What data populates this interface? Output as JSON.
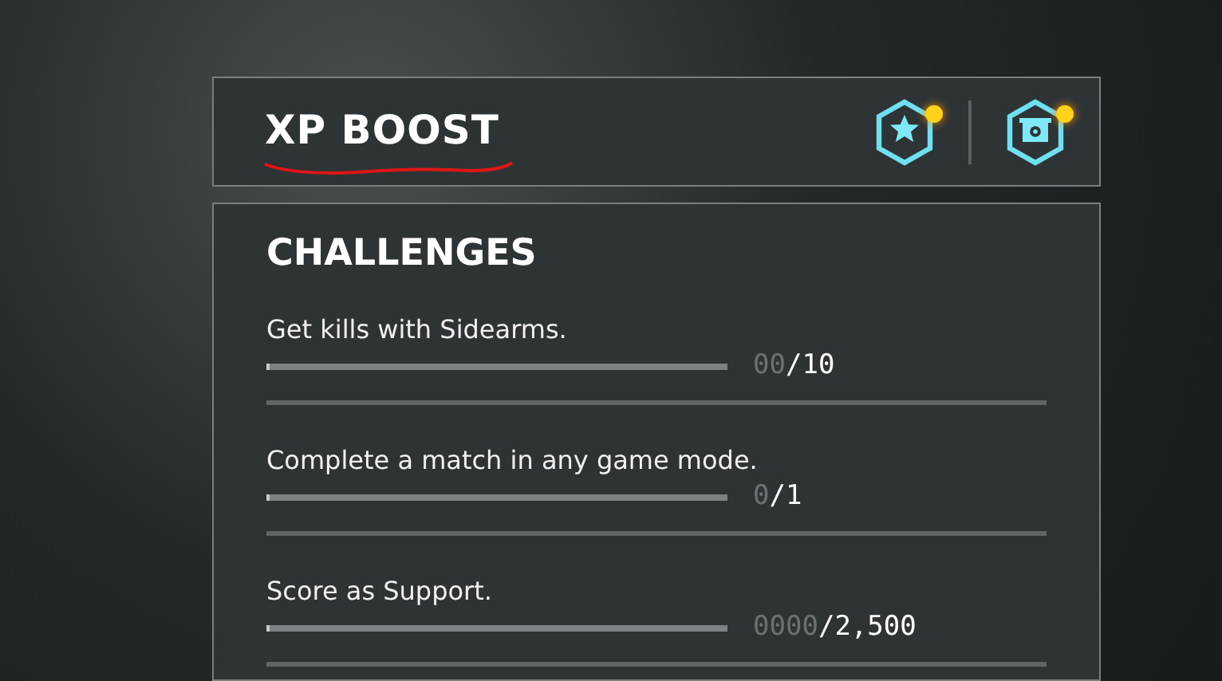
{
  "header": {
    "title": "XP BOOST",
    "title_underlined": true,
    "badges": [
      {
        "kind": "star",
        "notification": true
      },
      {
        "kind": "gear",
        "notification": true
      }
    ]
  },
  "challenges": {
    "title": "CHALLENGES",
    "items": [
      {
        "label": "Get kills with Sidearms.",
        "level": 0,
        "current": "00",
        "target": "/10"
      },
      {
        "label": "Complete a match in any game mode.",
        "level": 0,
        "current": "0",
        "target": "/1"
      },
      {
        "label": "Score as Support.",
        "level": 0,
        "current": "0000",
        "target": "/2,500"
      }
    ]
  }
}
